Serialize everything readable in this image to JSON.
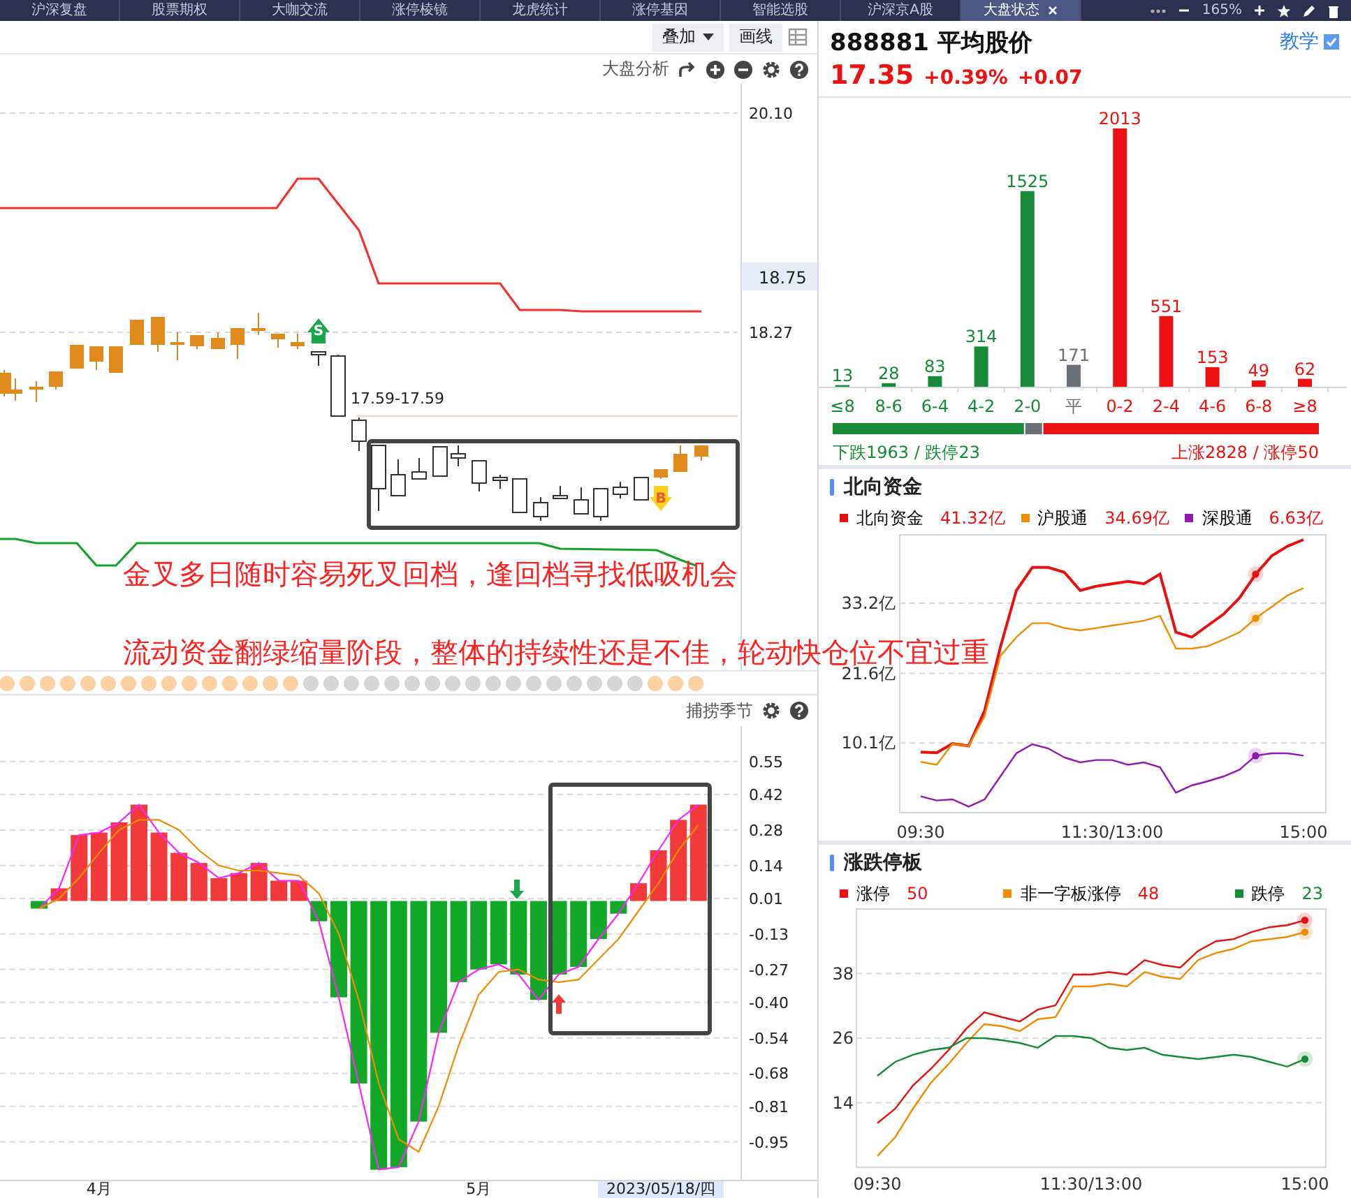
{
  "tabs": [
    {
      "label": "沪深复盘",
      "selected": false
    },
    {
      "label": "股票期权",
      "selected": false
    },
    {
      "label": "大咖交流",
      "selected": false
    },
    {
      "label": "涨停棱镜",
      "selected": false
    },
    {
      "label": "龙虎统计",
      "selected": false
    },
    {
      "label": "涨停基因",
      "selected": false
    },
    {
      "label": "智能选股",
      "selected": false
    },
    {
      "label": "沪深京A股",
      "selected": false
    },
    {
      "label": "大盘状态",
      "selected": true
    }
  ],
  "window_controls": {
    "zoom": "165%"
  },
  "toolbar": {
    "buttons": [
      {
        "label": "叠加",
        "kind": "dropdown"
      },
      {
        "label": "画线",
        "kind": "plain"
      }
    ]
  },
  "main_chart": {
    "title": "大盘分析",
    "price_ticks": [
      "20.10",
      "18.27"
    ],
    "current_price": "18.75",
    "range_label": "17.59-17.59",
    "markers": [
      {
        "label": "S",
        "kind": "sell"
      },
      {
        "label": "B",
        "kind": "buy"
      }
    ],
    "annotations": [
      "金叉多日随时容易死叉回档，逢回档寻找低吸机会",
      "流动资金翻绿缩量阶段，整体的持续性还是不佳，轮动快仓位不宜过重"
    ]
  },
  "signal_dots": [
    {
      "on": true
    },
    {
      "on": true
    },
    {
      "on": true
    },
    {
      "on": true
    },
    {
      "on": true
    },
    {
      "on": true
    },
    {
      "on": true
    },
    {
      "on": true
    },
    {
      "on": true
    },
    {
      "on": true
    },
    {
      "on": true
    },
    {
      "on": true
    },
    {
      "on": true
    },
    {
      "on": true
    },
    {
      "on": true
    },
    {
      "on": false
    },
    {
      "on": false
    },
    {
      "on": false
    },
    {
      "on": false
    },
    {
      "on": false
    },
    {
      "on": false
    },
    {
      "on": false
    },
    {
      "on": false
    },
    {
      "on": false
    },
    {
      "on": false
    },
    {
      "on": false
    },
    {
      "on": false
    },
    {
      "on": false
    },
    {
      "on": false
    },
    {
      "on": false
    },
    {
      "on": false
    },
    {
      "on": false
    },
    {
      "on": true
    },
    {
      "on": true
    },
    {
      "on": true
    }
  ],
  "indicator": {
    "title": "捕捞季节",
    "current_date": "2023/05/18/四",
    "chart_data": {
      "type": "bar",
      "stacked": true,
      "categories": [
        null,
        null,
        null,
        "4月",
        null,
        null,
        null,
        null,
        null,
        null,
        null,
        null,
        null,
        null,
        null,
        null,
        null,
        null,
        null,
        null,
        null,
        null,
        "5月",
        null,
        null,
        null,
        null,
        null,
        null,
        null,
        null,
        null,
        null,
        null
      ],
      "ylim": [
        -1.1,
        0.69
      ],
      "grid": true,
      "yticks": [
        0.55,
        0.42,
        0.28,
        0.14,
        0.01,
        -0.13,
        -0.27,
        {
          "value": -0.4,
          "label": "-0.40"
        },
        -0.54,
        -0.68,
        -0.81,
        -0.95
      ],
      "series": [
        {
          "color": "#f23a3a",
          "values": [
            null,
            0.05,
            0.26,
            0.27,
            0.31,
            0.38,
            0.27,
            0.19,
            0.15,
            0.09,
            0.11,
            0.15,
            0.08,
            0.08,
            null,
            null,
            null,
            null,
            null,
            null,
            null,
            null,
            null,
            null,
            null,
            null,
            null,
            null,
            null,
            null,
            0.07,
            0.2,
            0.32,
            0.38
          ]
        },
        {
          "color": "#12a828",
          "values": [
            -0.03,
            null,
            null,
            null,
            null,
            null,
            null,
            null,
            null,
            null,
            null,
            null,
            null,
            null,
            -0.08,
            -0.38,
            -0.72,
            -1.06,
            -1.05,
            -0.87,
            -0.52,
            -0.32,
            -0.27,
            -0.25,
            -0.29,
            -0.39,
            -0.29,
            -0.26,
            -0.15,
            -0.05,
            null,
            null,
            null,
            null
          ]
        },
        {
          "type": "line",
          "color": "#ff22ff",
          "values": [
            -0.03,
            0.05,
            0.26,
            0.27,
            0.31,
            0.38,
            0.27,
            0.19,
            0.15,
            0.09,
            0.11,
            0.15,
            0.08,
            0.08,
            -0.08,
            -0.38,
            -0.72,
            -1.06,
            -1.05,
            -0.87,
            -0.52,
            -0.32,
            -0.27,
            -0.25,
            -0.29,
            -0.39,
            -0.29,
            -0.26,
            -0.15,
            -0.05,
            0.07,
            0.2,
            0.32,
            0.38
          ]
        },
        {
          "type": "line",
          "color": "#f08c00",
          "values": [
            -0.03,
            0.01,
            0.09,
            0.19,
            0.28,
            0.32,
            0.32,
            0.28,
            0.2,
            0.14,
            0.12,
            0.12,
            0.11,
            0.1,
            0.03,
            -0.13,
            -0.39,
            -0.72,
            -0.94,
            -0.99,
            -0.81,
            -0.57,
            -0.37,
            -0.28,
            -0.27,
            -0.31,
            -0.32,
            -0.31,
            -0.23,
            -0.15,
            -0.04,
            0.07,
            0.2,
            0.3
          ]
        }
      ]
    }
  },
  "quote": {
    "title": "888881 平均股价",
    "link": "教学",
    "price": "17.35",
    "change_pct": "+0.39%",
    "change": "+0.07"
  },
  "distribution": {
    "chart_data": {
      "type": "bar",
      "stacked": true,
      "data_labels": true,
      "categories": [
        "≤8",
        "8-6",
        "6-4",
        "4-2",
        "2-0",
        "平",
        "0-2",
        "2-4",
        "4-6",
        "6-8",
        "≥8"
      ],
      "series": [
        {
          "color": "#178a3a",
          "values": [
            13,
            28,
            83,
            314,
            1525,
            null,
            null,
            null,
            null,
            null,
            null
          ]
        },
        {
          "color": "#6b6f76",
          "values": [
            null,
            null,
            null,
            null,
            null,
            171,
            null,
            null,
            null,
            null,
            null
          ]
        },
        {
          "color": "#ee1111",
          "values": [
            null,
            null,
            null,
            null,
            null,
            null,
            2013,
            551,
            153,
            49,
            62
          ]
        }
      ]
    },
    "down_summary": "下跌1963 / 跌停23",
    "up_summary": "上涨2828 / 涨停50"
  },
  "northbound": {
    "title": "北向资金",
    "legend": [
      {
        "name": "北向资金",
        "value": "41.32亿",
        "color": "#e81010",
        "falling": false
      },
      {
        "name": "沪股通",
        "value": "34.69亿",
        "color": "#f08c00",
        "falling": false
      },
      {
        "name": "深股通",
        "value": "6.63亿",
        "color": "#8e1cb0",
        "falling": false
      }
    ],
    "chart_data": {
      "type": "line",
      "categories": [
        "09:30",
        null,
        null,
        null,
        null,
        null,
        null,
        null,
        null,
        null,
        null,
        null,
        "11:30/13:00",
        null,
        null,
        null,
        null,
        null,
        null,
        null,
        null,
        null,
        null,
        null,
        "15:00"
      ],
      "ylim": [
        -1.4,
        44.5
      ],
      "grid": true,
      "yticks": [
        {
          "value": 10.1,
          "label": "10.1亿"
        },
        {
          "value": 21.6,
          "label": "21.6亿"
        },
        {
          "value": 33.2,
          "label": "33.2亿"
        }
      ],
      "series": [
        {
          "color": "#e81010",
          "values": [
            8.6,
            8.5,
            10,
            9.6,
            15.4,
            26,
            35.3,
            39.1,
            39.1,
            38.3,
            35.3,
            36,
            36.4,
            36.8,
            36.4,
            38,
            28.4,
            27.6,
            29.5,
            31.4,
            34.1,
            38,
            41,
            42.6,
            43.7
          ]
        },
        {
          "color": "#f08c00",
          "values": [
            7,
            6.5,
            10,
            9.6,
            14.5,
            24.5,
            27.6,
            29.9,
            29.9,
            29.1,
            28.7,
            29.1,
            29.5,
            29.9,
            30.3,
            31.1,
            25.7,
            25.7,
            26.1,
            27.2,
            28.4,
            30.7,
            32.6,
            34.5,
            35.7
          ]
        },
        {
          "color": "#8e1cb0",
          "values": [
            1.3,
            0.6,
            0.8,
            -0.4,
            0.8,
            4.6,
            8.4,
            9.9,
            9.2,
            7.7,
            6.9,
            7.3,
            7.3,
            6.5,
            6.9,
            6.1,
            1.9,
            3.1,
            3.8,
            4.6,
            5.7,
            8,
            8.4,
            8.4,
            8
          ]
        }
      ]
    }
  },
  "limit_board": {
    "title": "涨跌停板",
    "legend": [
      {
        "name": "涨停",
        "value": "50",
        "color": "#e81010",
        "falling": false
      },
      {
        "name": "非一字板涨停",
        "value": "48",
        "color": "#f08c00",
        "falling": false
      },
      {
        "name": "跌停",
        "value": "23",
        "color": "#178a3a",
        "falling": true
      }
    ],
    "chart_data": {
      "type": "line",
      "categories": [
        "09:30",
        null,
        null,
        null,
        null,
        null,
        null,
        null,
        null,
        null,
        null,
        null,
        "11:30/13:00",
        null,
        null,
        null,
        null,
        null,
        null,
        null,
        null,
        null,
        null,
        null,
        "15:00"
      ],
      "ylim": [
        2,
        50
      ],
      "grid": true,
      "yticks": [
        14,
        26,
        38
      ],
      "series": [
        {
          "color": "#e81010",
          "values": [
            10.2,
            12.9,
            17.2,
            20.3,
            23.8,
            27.8,
            30.8,
            29.9,
            29.1,
            31.3,
            32.1,
            37.8,
            37.8,
            38.3,
            37.8,
            40.5,
            39.6,
            39.1,
            42.2,
            44,
            44.4,
            45.7,
            46.6,
            47,
            47.9
          ]
        },
        {
          "color": "#f08c00",
          "values": [
            4.1,
            7.6,
            12.9,
            17.7,
            21.2,
            25.1,
            28.6,
            28.2,
            27.3,
            29.5,
            29.9,
            35.6,
            35.6,
            36.1,
            35.6,
            38.3,
            37.4,
            37,
            40.5,
            41.8,
            42.6,
            44,
            44.4,
            44.8,
            45.7
          ]
        },
        {
          "color": "#178a3a",
          "values": [
            19,
            21.6,
            22.9,
            23.8,
            24.2,
            26,
            26,
            25.6,
            25.1,
            24.2,
            26.4,
            26.4,
            26,
            24.2,
            23.8,
            24.2,
            22.9,
            22.5,
            22.1,
            22.5,
            22.9,
            22.5,
            21.6,
            20.7,
            22.1
          ]
        }
      ]
    }
  }
}
